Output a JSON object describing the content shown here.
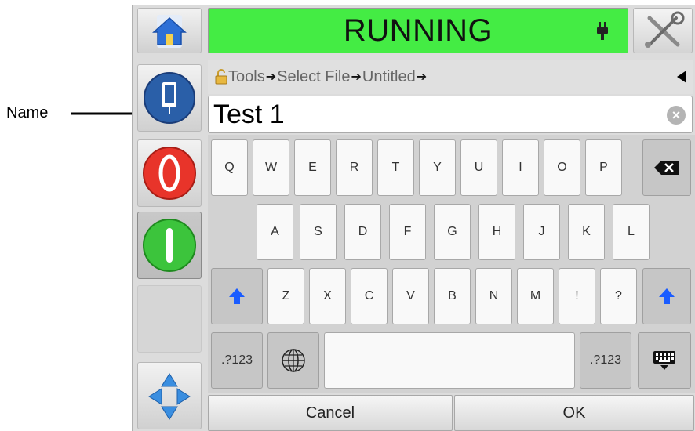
{
  "annotation": {
    "label": "Name"
  },
  "status": {
    "text": "RUNNING",
    "color": "#44ec44"
  },
  "breadcrumb": {
    "items": [
      "Tools",
      "Select File",
      "Untitled"
    ],
    "separator": "➔"
  },
  "name_field": {
    "value": "Test 1"
  },
  "keyboard": {
    "row1": [
      "Q",
      "W",
      "E",
      "R",
      "T",
      "Y",
      "U",
      "I",
      "O",
      "P"
    ],
    "row2": [
      "A",
      "S",
      "D",
      "F",
      "G",
      "H",
      "J",
      "K",
      "L"
    ],
    "row3": [
      "Z",
      "X",
      "C",
      "V",
      "B",
      "N",
      "M",
      "!",
      "?"
    ],
    "symbols_left": ".?123",
    "symbols_right": ".?123"
  },
  "actions": {
    "cancel": "Cancel",
    "ok": "OK"
  },
  "icons": {
    "home": "home-icon",
    "tools": "tools-icon",
    "lock": "lock-icon",
    "back": "triangle-left-icon",
    "clear": "clear-circle-icon",
    "backspace": "backspace-icon",
    "shift": "shift-arrow-icon",
    "globe": "globe-icon",
    "hide_keyboard": "keyboard-icon",
    "stop": "stop-icon",
    "start": "start-icon",
    "ink": "ink-cartridge-icon",
    "navigate": "navigate-arrows-icon",
    "printer_status": "printhead-icon"
  },
  "colors": {
    "stop": "#e8342a",
    "start": "#3cc43c",
    "shift": "#1a5cff",
    "ink": "#2a5fa8"
  }
}
